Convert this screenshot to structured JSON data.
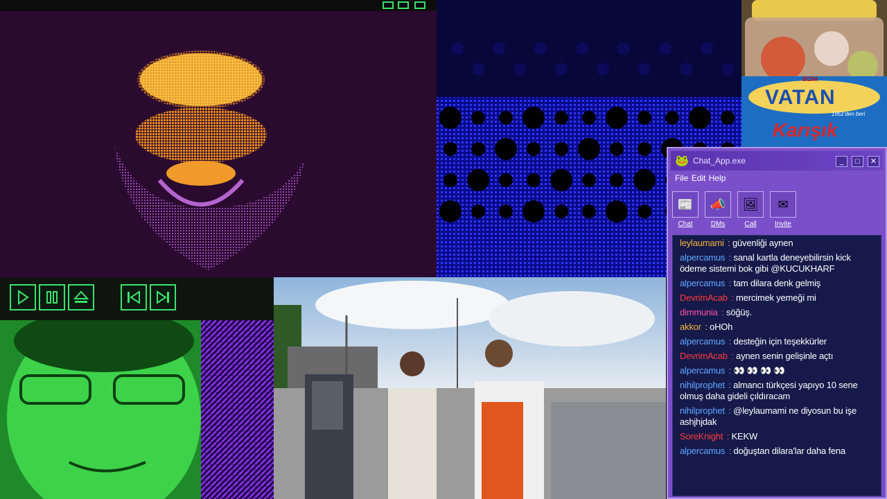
{
  "colors": {
    "chat_window": "#7b4fc9",
    "chat_log_bg": "#161a4a",
    "player_green": "#3be36a"
  },
  "media_controls": {
    "buttons": [
      "play-icon",
      "pause-icon",
      "eject-icon",
      "previous-icon",
      "next-icon"
    ]
  },
  "jar_label": {
    "brand_small": "BİZİM",
    "brand": "VATAN",
    "since": "1951'den beri",
    "variant": "Karışık"
  },
  "chat": {
    "title": "Chat_App.exe",
    "menu": [
      "File",
      "Edit",
      "Help"
    ],
    "toolbar": [
      {
        "label": "Chat",
        "icon": "chat-icon"
      },
      {
        "label": "DMs",
        "icon": "megaphone-icon"
      },
      {
        "label": "Call",
        "icon": "call-icon"
      },
      {
        "label": "Invite",
        "icon": "invite-icon"
      }
    ],
    "messages": [
      {
        "user": "leylaumami",
        "color": "#f2b53a",
        "text": "güvenliği aynen"
      },
      {
        "user": "alpercamus",
        "color": "#5fa8ff",
        "text": "sanal kartla deneyebilirsin kick ödeme sistemi bok gibi @KUCUKHARF"
      },
      {
        "user": "alpercamus",
        "color": "#5fa8ff",
        "text": "tam dilara denk gelmiş"
      },
      {
        "user": "DevrimAcab",
        "color": "#ff3b3b",
        "text": "mercimek yemeği mi"
      },
      {
        "user": "dimmunia",
        "color": "#ff4fa8",
        "text": "söğüş."
      },
      {
        "user": "akkor",
        "color": "#f2b53a",
        "text": "oHOh"
      },
      {
        "user": "alpercamus",
        "color": "#5fa8ff",
        "text": "desteğin için teşekkürler"
      },
      {
        "user": "DevrimAcab",
        "color": "#ff3b3b",
        "text": "aynen senin gelişinle açtı"
      },
      {
        "user": "alpercamus",
        "color": "#5fa8ff",
        "text": "👀 👀 👀 👀"
      },
      {
        "user": "nihilprophet",
        "color": "#5fa8ff",
        "text": "almancı türkçesi yapıyo 10 sene olmuş daha gideli çıldıracam"
      },
      {
        "user": "nihilprophet",
        "color": "#5fa8ff",
        "text": "@leylaumami ne diyosun bu işe ashjhjdak"
      },
      {
        "user": "SoreKnight",
        "color": "#ff3b3b",
        "text": "KEKW"
      },
      {
        "user": "alpercamus",
        "color": "#5fa8ff",
        "text": "doğuştan dilara'lar daha fena"
      }
    ]
  }
}
